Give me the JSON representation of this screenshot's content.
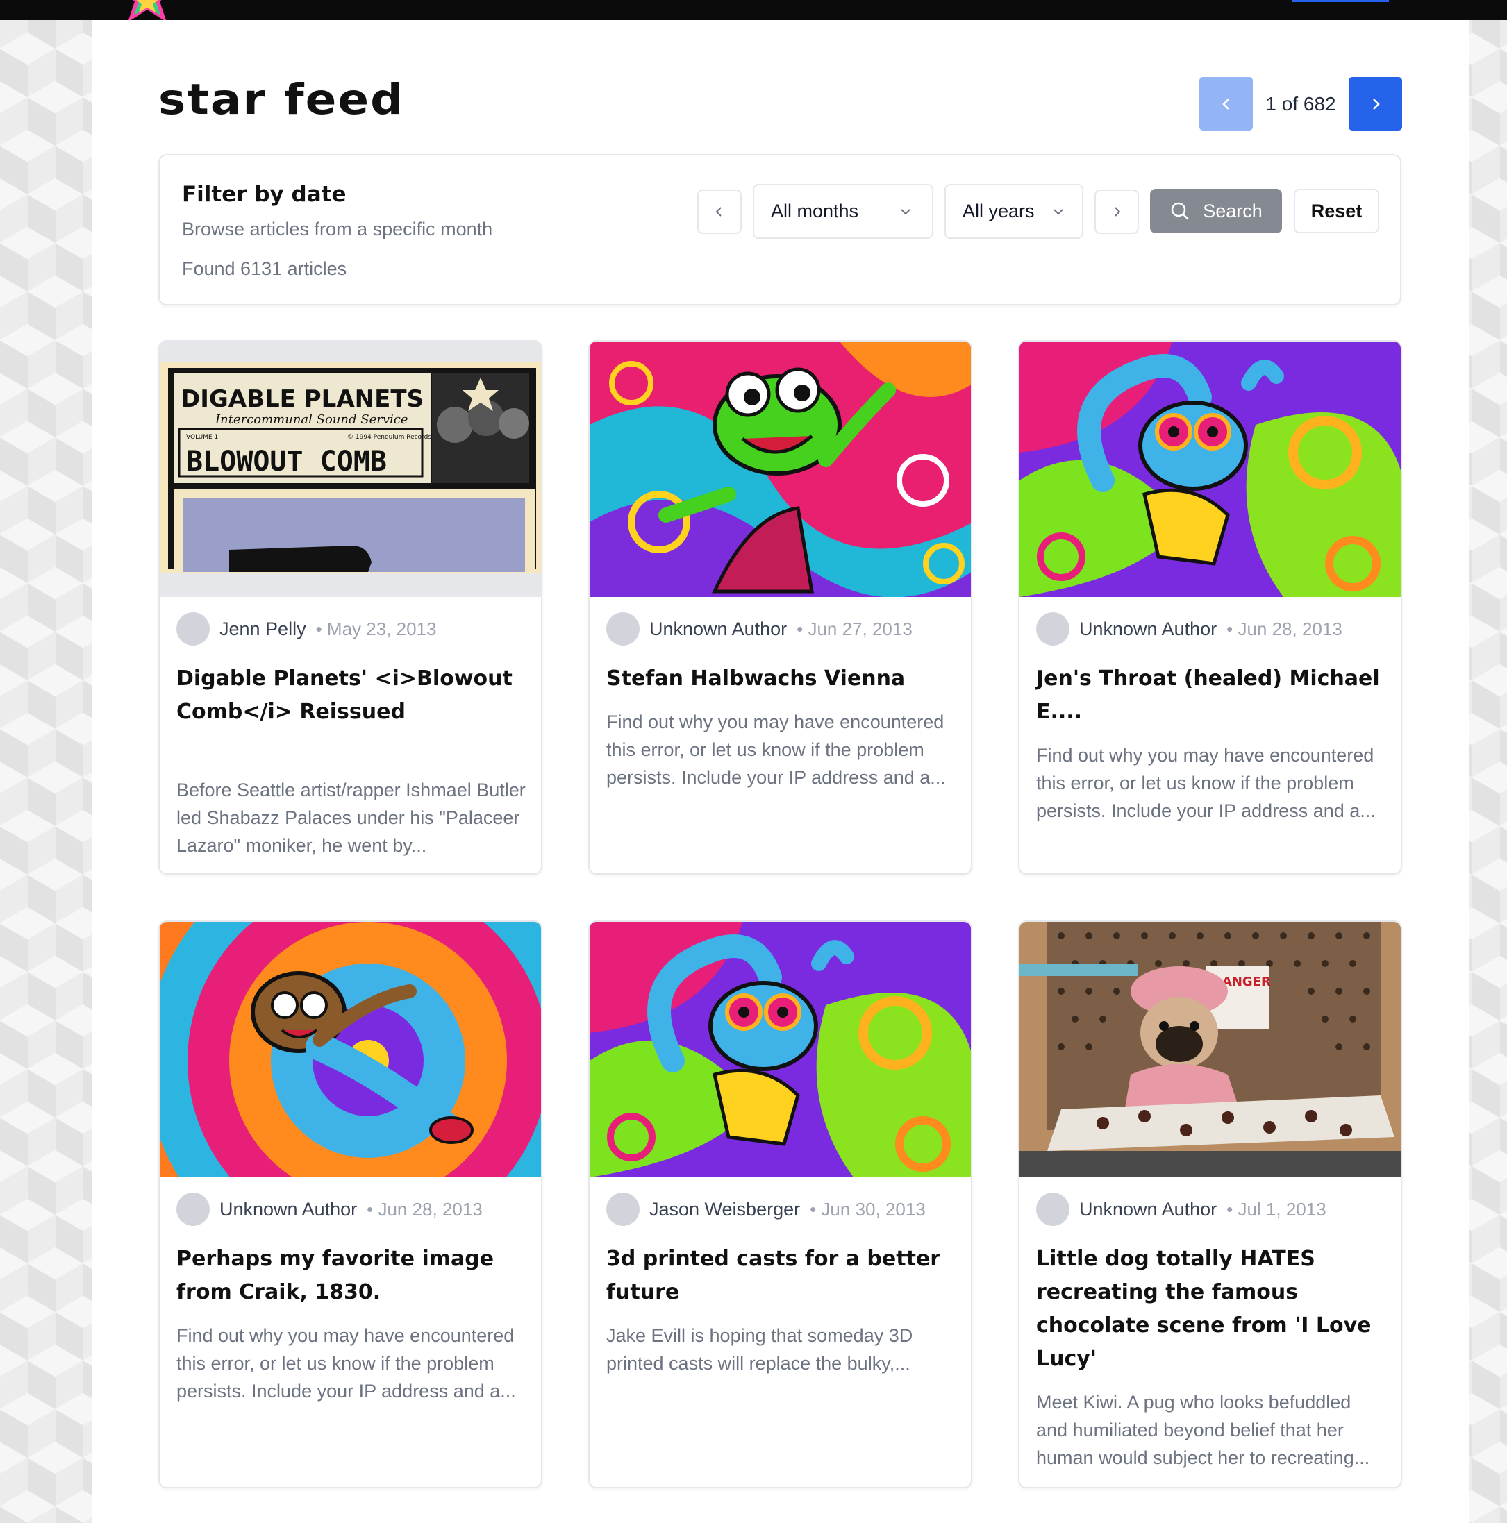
{
  "header": {
    "title": "star feed",
    "pagination": {
      "text": "1 of 682",
      "prev_icon": "chevron-left-icon",
      "next_icon": "chevron-right-icon"
    },
    "accent": "#2563eb"
  },
  "filter": {
    "title": "Filter by date",
    "subtitle": "Browse articles from a specific month",
    "count": "Found 6131 articles",
    "month_select": "All months",
    "year_select": "All years",
    "search_label": "Search",
    "reset_label": "Reset"
  },
  "articles": [
    {
      "author": "Jenn Pelly",
      "date": "• May 23, 2013",
      "title": "Digable Planets' <i>Blowout Comb</i> Reissued",
      "excerpt": "Before Seattle artist/rapper Ishmael Butler led Shabazz Palaces under his \"Palaceer Lazaro\" moniker, he went by...",
      "image": {
        "kind": "album-cover",
        "band": "DIGABLE PLANETS",
        "subtitle": "Intercommunal Sound Service",
        "volume": "VOLUME 1",
        "copyright": "© 1994 Pendulum Records",
        "album": "BLOWOUT COMB"
      }
    },
    {
      "author": "Unknown Author",
      "date": "• Jun 27, 2013",
      "title": "Stefan Halbwachs Vienna",
      "excerpt": "Find out why you may have encountered this error, or let us know if the problem persists. Include your IP address and a...",
      "image": {
        "kind": "psychedelic-frog-illustration"
      }
    },
    {
      "author": "Unknown Author",
      "date": "• Jun 28, 2013",
      "title": "Jen's Throat (healed) Michael E....",
      "excerpt": "Find out why you may have encountered this error, or let us know if the problem persists. Include your IP address and a...",
      "image": {
        "kind": "psychedelic-creature-illustration"
      }
    },
    {
      "author": "Unknown Author",
      "date": "• Jun 28, 2013",
      "title": "Perhaps my favorite image from Craik, 1830.",
      "excerpt": "Find out why you may have encountered this error, or let us know if the problem persists. Include your IP address and a...",
      "image": {
        "kind": "psychedelic-monkey-illustration"
      }
    },
    {
      "author": "Jason Weisberger",
      "date": "• Jun 30, 2013",
      "title": "3d printed casts for a better future",
      "excerpt": "Jake Evill is hoping that someday 3D printed casts will replace the bulky,...",
      "image": {
        "kind": "psychedelic-creature-illustration"
      }
    },
    {
      "author": "Unknown Author",
      "date": "• Jul 1, 2013",
      "title": "Little dog totally HATES recreating the famous chocolate scene from 'I Love Lucy'",
      "excerpt": "Meet Kiwi. A pug who looks befuddled and humiliated beyond belief that her human would subject her to recreating...",
      "image": {
        "kind": "pug-photo",
        "sign": "DANGER"
      }
    }
  ]
}
